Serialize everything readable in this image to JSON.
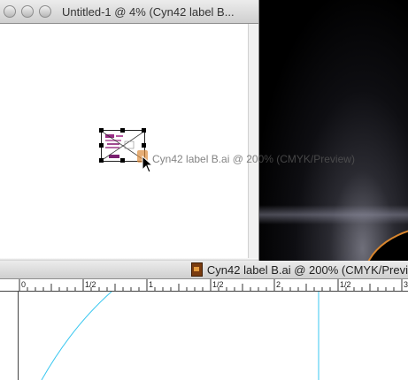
{
  "windows": {
    "top": {
      "title": "Untitled-1 @ 4% (Cyn42 label B..."
    },
    "bottom": {
      "title": "Cyn42 label B.ai @ 200% (CMYK/Previ"
    }
  },
  "drag": {
    "label": "Cyn42 label B.ai @ 200% (CMYK/Preview)"
  },
  "ruler": {
    "labels": [
      "0",
      "1/2",
      "1",
      "1/2",
      "2",
      "1/2",
      "3"
    ]
  },
  "icons": {
    "traffic_lights": [
      "close-icon",
      "minimize-icon",
      "zoom-icon"
    ],
    "doc": "illustrator-document-icon",
    "cursor": "arrow-cursor-icon"
  },
  "colors": {
    "guide": "#38c7f0",
    "art_magenta": "#9a2d86"
  }
}
